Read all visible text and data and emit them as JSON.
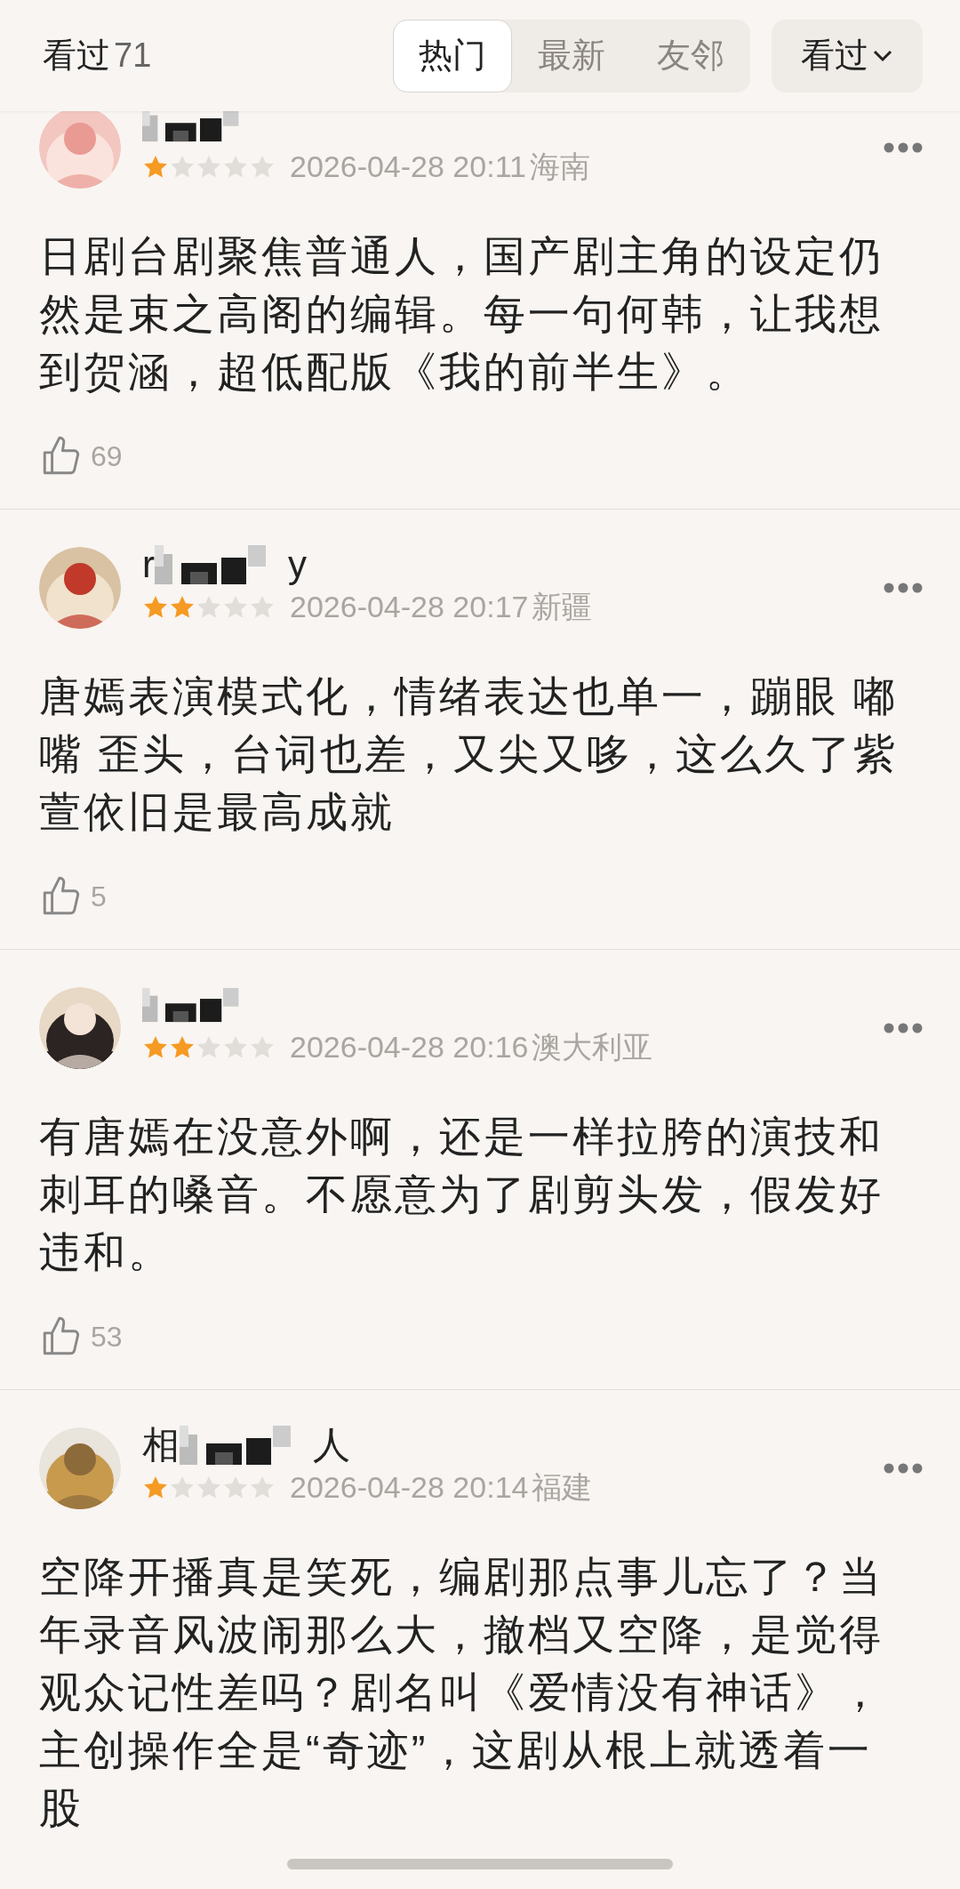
{
  "header": {
    "title": "看过",
    "count": "71",
    "tabs": [
      {
        "label": "热门",
        "selected": true
      },
      {
        "label": "最新",
        "selected": false
      },
      {
        "label": "友邻",
        "selected": false
      }
    ],
    "filter": {
      "label": "看过"
    }
  },
  "comments": [
    {
      "stars": 1,
      "time": "2026-04-28 20:11",
      "region": "海南",
      "text": "日剧台剧聚焦普通人，国产剧主角的设定仍然是束之高阁的编辑。每一句何韩，让我想到贺涵，超低配版《我的前半生》。",
      "likes": "69"
    },
    {
      "name_start": "r",
      "name_end": "y",
      "stars": 2,
      "time": "2026-04-28 20:17",
      "region": "新疆",
      "text": "唐嫣表演模式化，情绪表达也单一，蹦眼 嘟嘴 歪头，台词也差，又尖又哆，这么久了紫萱依旧是最高成就",
      "likes": "5"
    },
    {
      "stars": 2,
      "time": "2026-04-28 20:16",
      "region": "澳大利亚",
      "text": "有唐嫣在没意外啊，还是一样拉胯的演技和刺耳的嗓音。不愿意为了剧剪头发，假发好违和。",
      "likes": "53"
    },
    {
      "name_start": "相",
      "name_end": "人",
      "stars": 1,
      "time": "2026-04-28 20:14",
      "region": "福建",
      "text": "空降开播真是笑死，编剧那点事儿忘了？当年录音风波闹那么大，撤档又空降，是觉得观众记性差吗？剧名叫《爱情没有神话》，主创操作全是“奇迹”，这剧从根上就透着一股"
    }
  ]
}
